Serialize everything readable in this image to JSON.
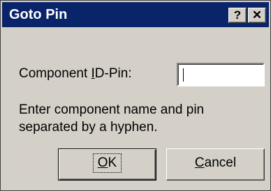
{
  "window": {
    "title": "Goto Pin",
    "help_label": "?",
    "close_label": "✕"
  },
  "form": {
    "label_prefix": "Component ",
    "label_accel": "I",
    "label_suffix": "D-Pin:",
    "input_value": "",
    "hint": "Enter component name and pin separated by a hyphen."
  },
  "buttons": {
    "ok_accel": "O",
    "ok_rest": "K",
    "cancel_accel": "C",
    "cancel_rest": "ancel"
  },
  "colors": {
    "titlebar": "#0a246a",
    "face": "#d4d0c8"
  }
}
